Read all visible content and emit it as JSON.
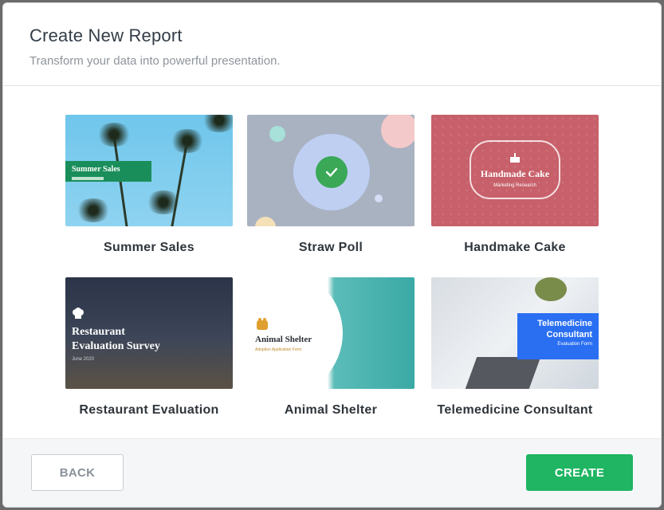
{
  "dialog": {
    "title": "Create New Report",
    "subtitle": "Transform your data into powerful presentation."
  },
  "templates": [
    {
      "label": "Summer Sales",
      "thumb_text": "Summer Sales"
    },
    {
      "label": "Straw Poll"
    },
    {
      "label": "Handmake Cake",
      "thumb_text": "Handmade Cake",
      "thumb_sub": "Marketing Research"
    },
    {
      "label": "Restaurant Evaluation",
      "thumb_text_line1": "Restaurant",
      "thumb_text_line2": "Evaluation Survey",
      "thumb_sub": "June 2020"
    },
    {
      "label": "Animal Shelter",
      "thumb_text": "Animal Shelter",
      "thumb_sub": "Adoption Application Form"
    },
    {
      "label": "Telemedicine Consultant",
      "thumb_text_line1": "Telemedicine",
      "thumb_text_line2": "Consultant",
      "thumb_sub": "Evaluation Form"
    }
  ],
  "footer": {
    "back_label": "BACK",
    "create_label": "CREATE"
  },
  "colors": {
    "primary": "#1fb562",
    "selected_check": "#3aa857",
    "title_text": "#333d47",
    "subtitle_text": "#8e959c"
  }
}
